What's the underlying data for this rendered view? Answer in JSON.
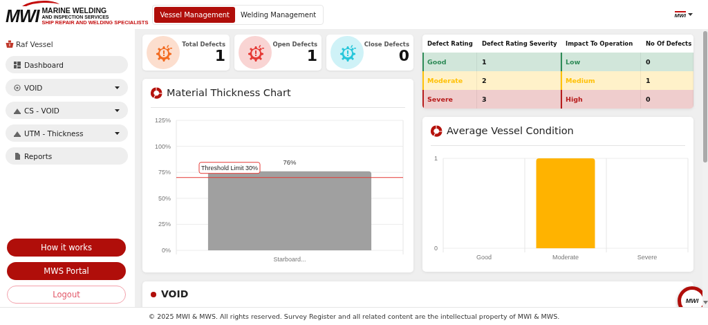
{
  "header": {
    "logo": {
      "mark": "MWI",
      "name": "MARINE WELDING",
      "subtitle": "AND INSPECTION SERVICES",
      "tagline": "SHIP REPAIR AND WELDING SPECIALISTS"
    },
    "tabs": [
      {
        "label": "Vessel Management",
        "selected": true
      },
      {
        "label": "Welding Management",
        "selected": false
      }
    ],
    "user_menu": {
      "logo": "MWI"
    }
  },
  "sidebar": {
    "vessel": "Raf Vessel",
    "items": [
      {
        "label": "Dashboard",
        "kind": "link"
      },
      {
        "label": "VOID",
        "kind": "dropdown"
      },
      {
        "label": "CS - VOID",
        "kind": "dropdown"
      },
      {
        "label": "UTM - Thickness",
        "kind": "dropdown"
      },
      {
        "label": "Reports",
        "kind": "link"
      }
    ],
    "buttons": [
      {
        "label": "How it works",
        "kind": "filled"
      },
      {
        "label": "MWS Portal",
        "kind": "filled"
      },
      {
        "label": "Logout",
        "kind": "outline"
      }
    ]
  },
  "stats": [
    {
      "label": "Total Defects",
      "value": "1",
      "color": "#f26b21"
    },
    {
      "label": "Open Defects",
      "value": "1",
      "color": "#e53935"
    },
    {
      "label": "Close Defects",
      "value": "0",
      "color": "#26c6da"
    }
  ],
  "defect_table": {
    "columns": [
      "Defect Rating",
      "Defect Rating Severity",
      "Impact To Operation",
      "No Of Defects"
    ],
    "rows": [
      {
        "rating": "Good",
        "severity": "1",
        "impact": "Low",
        "defects": "0",
        "color": "#2e8b57"
      },
      {
        "rating": "Moderate",
        "severity": "2",
        "impact": "Medium",
        "defects": "1",
        "color": "#ffc107"
      },
      {
        "rating": "Severe",
        "severity": "3",
        "impact": "High",
        "defects": "0",
        "color": "#b71c1c"
      }
    ]
  },
  "material_chart": {
    "title": "Material Thickness Chart",
    "chart_data": {
      "type": "bar",
      "categories": [
        "Starboard..."
      ],
      "series": [
        {
          "color": "#a0a0a0",
          "values": [
            76
          ]
        }
      ],
      "ylim": [
        0,
        125
      ],
      "yticks": [
        {
          "value": 0,
          "label": "0%"
        },
        {
          "value": 25,
          "label": "25%"
        },
        {
          "value": 50,
          "label": "50%"
        },
        {
          "value": 75,
          "label": "75%"
        },
        {
          "value": 100,
          "label": "100%"
        },
        {
          "value": 125,
          "label": "125%"
        }
      ],
      "value_labels": [
        "76%"
      ],
      "grid": true,
      "ref_lines": [
        {
          "axis": "y",
          "value": 70,
          "label": "Threshold Limit 30%",
          "color": "#e53935"
        }
      ]
    }
  },
  "vessel_chart": {
    "title": "Average Vessel Condition",
    "chart_data": {
      "type": "bar",
      "categories": [
        "Good",
        "Moderate",
        "Severe"
      ],
      "series": [
        {
          "color": "#ffb300",
          "values": [
            0,
            1,
            0
          ]
        }
      ],
      "ylim": [
        0,
        1
      ],
      "yticks": [
        0,
        1
      ],
      "grid": true
    }
  },
  "sections": [
    {
      "title": "VOID"
    }
  ],
  "help_button": {
    "logo": "MWI"
  },
  "footer": "© 2025 MWI & MWS. All rights reserved. Survey Register and all related content are the intellectual property of MWI & MWS."
}
